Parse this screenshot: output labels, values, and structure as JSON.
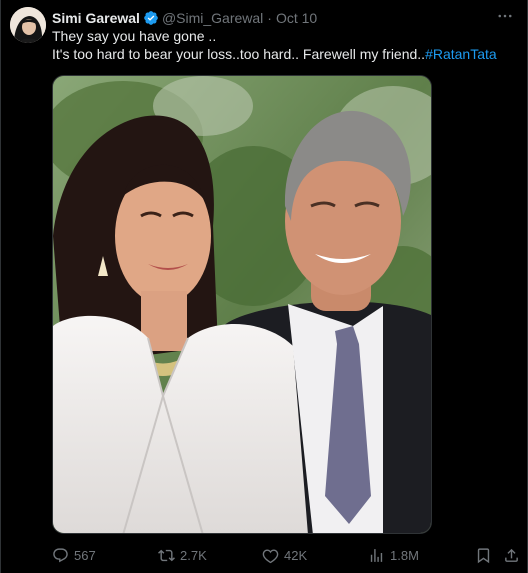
{
  "author": {
    "display_name": "Simi Garewal",
    "handle": "@Simi_Garewal",
    "separator": "·",
    "date": "Oct 10",
    "verified": true,
    "avatar_icon": "avatar-portrait"
  },
  "tweet": {
    "line1": "They say you have gone ..",
    "line2_text": "It's too hard to bear your loss..too hard.. Farewell my friend..",
    "hashtag": "#RatanTata"
  },
  "media": {
    "type": "photo"
  },
  "actions": {
    "replies": "567",
    "reposts": "2.7K",
    "likes": "42K",
    "views": "1.8M"
  },
  "colors": {
    "background": "#000000",
    "text": "#e7e9ea",
    "muted": "#71767b",
    "link": "#1d9bf0",
    "verified": "#1d9bf0",
    "border": "#2f3336"
  },
  "icons": {
    "more": "more-icon",
    "reply": "reply-icon",
    "repost": "repost-icon",
    "like": "heart-icon",
    "views": "views-icon",
    "bookmark": "bookmark-icon",
    "share": "share-icon"
  }
}
